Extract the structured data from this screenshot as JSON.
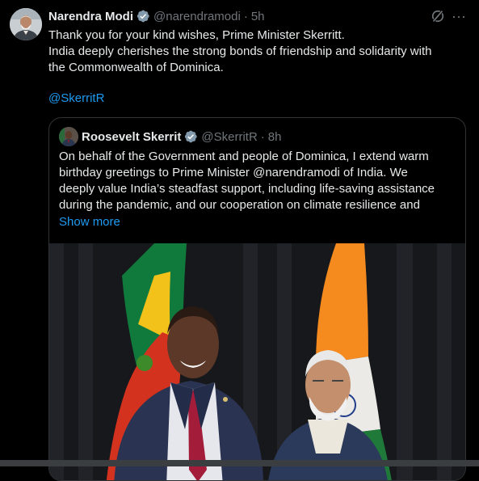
{
  "post": {
    "author_name": "Narendra Modi",
    "handle": "@narendramodi",
    "separator": "·",
    "time": "5h",
    "more_label": "···",
    "lines": [
      "Thank you for your kind wishes, Prime Minister Skerritt.",
      "India deeply cherishes the strong bonds of friendship and solidarity with",
      "the Commonwealth of Dominica."
    ],
    "mention": "@SkerritR"
  },
  "quote": {
    "author_name": "Roosevelt Skerrit",
    "handle": "@SkerritR",
    "separator": "·",
    "time": "8h",
    "lines": [
      "On behalf of the Government and people of Dominica, I extend warm",
      "birthday greetings to Prime Minister @narendramodi of India. We",
      "deeply value India’s steadfast support, including life-saving assistance",
      "during the pandemic, and our cooperation on climate resilience and"
    ],
    "show_more": "Show more"
  },
  "colors": {
    "background": "#000000",
    "text": "#e7e9ea",
    "muted": "#71767b",
    "link": "#1d9bf0",
    "border": "#2f3336"
  },
  "icons": [
    "verified-badge-icon",
    "grok-icon",
    "more-options-icon"
  ]
}
